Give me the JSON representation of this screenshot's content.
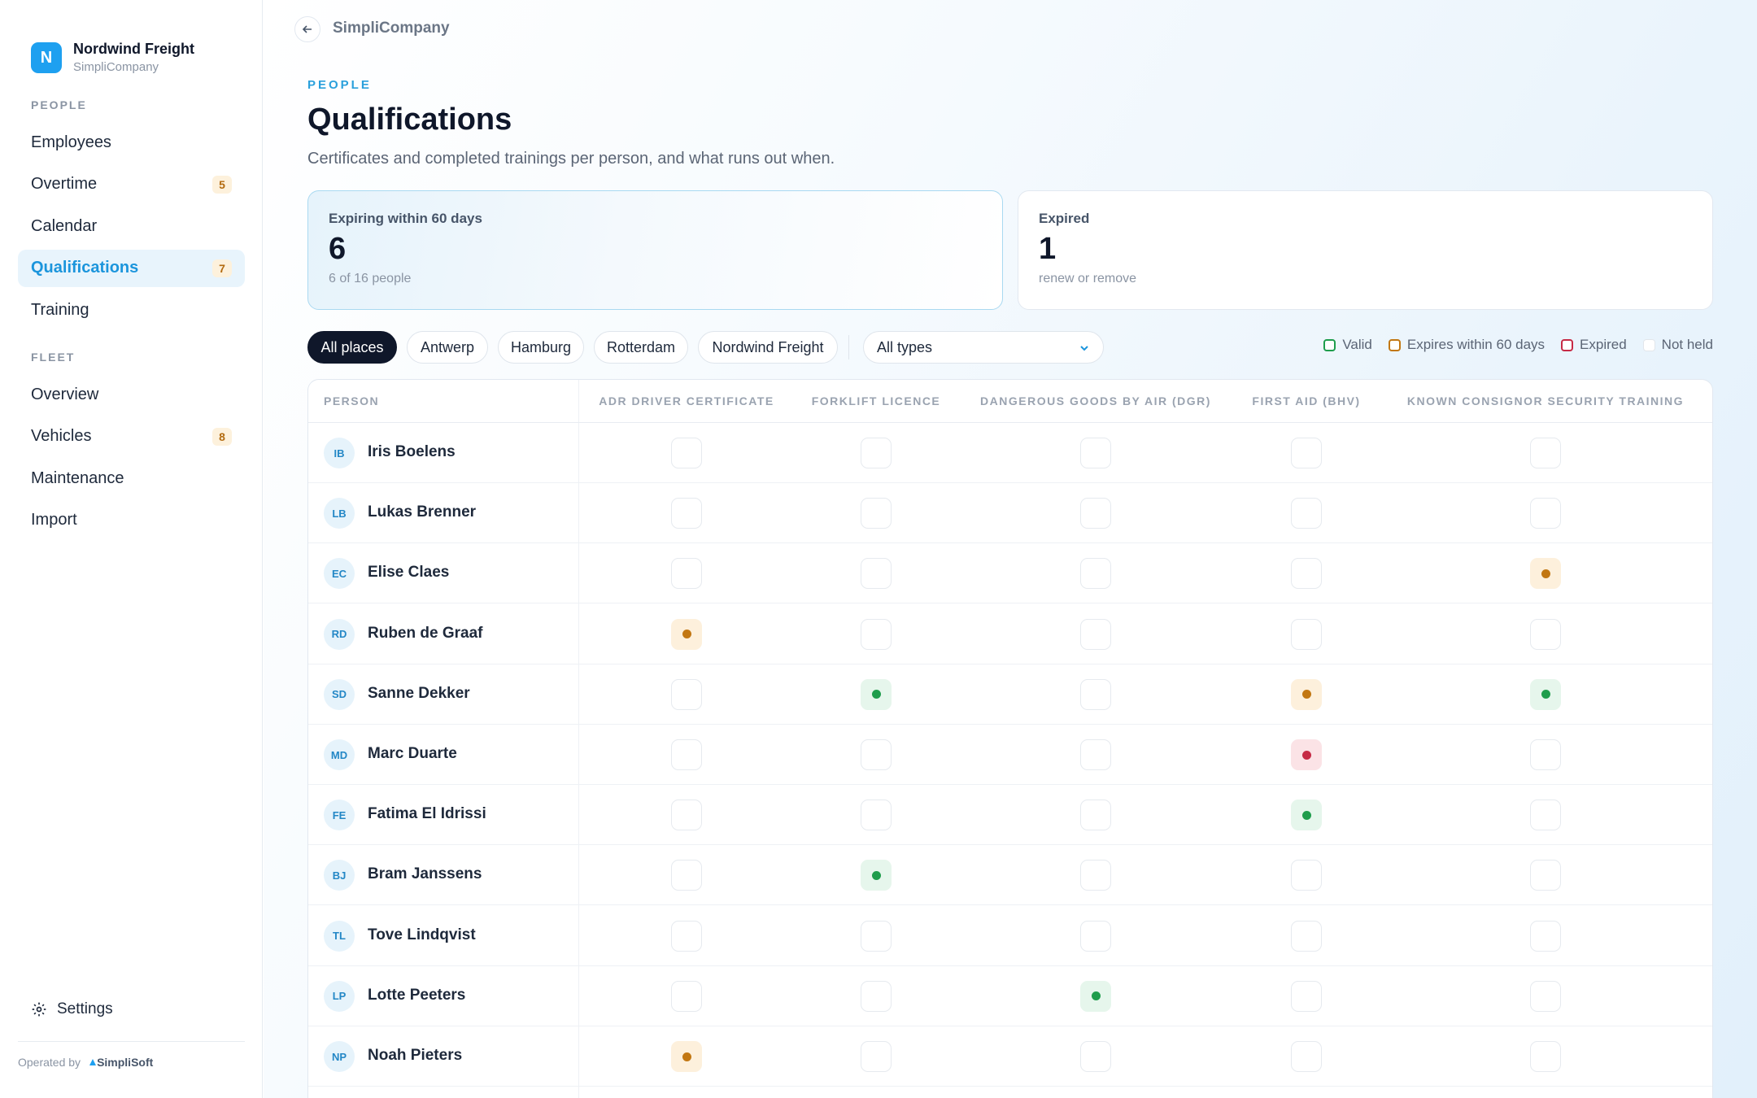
{
  "brand": {
    "logo_letter": "N",
    "name": "Nordwind Freight",
    "sub": "SimpliCompany"
  },
  "nav": {
    "people_label": "PEOPLE",
    "people_items": [
      {
        "label": "Employees",
        "badge": ""
      },
      {
        "label": "Overtime",
        "badge": "5"
      },
      {
        "label": "Calendar",
        "badge": ""
      },
      {
        "label": "Qualifications",
        "badge": "7",
        "active": true
      },
      {
        "label": "Training",
        "badge": ""
      }
    ],
    "fleet_label": "FLEET",
    "fleet_items": [
      {
        "label": "Overview",
        "badge": ""
      },
      {
        "label": "Vehicles",
        "badge": "8"
      },
      {
        "label": "Maintenance",
        "badge": ""
      },
      {
        "label": "Import",
        "badge": ""
      }
    ],
    "settings_label": "Settings",
    "operated_label": "Operated by",
    "operated_brand": "SimpliSoft"
  },
  "header": {
    "breadcrumb": "SimpliCompany",
    "eyebrow": "PEOPLE",
    "title": "Qualifications",
    "description": "Certificates and completed trainings per person, and what runs out when."
  },
  "stats": [
    {
      "label": "Expiring within 60 days",
      "value": "6",
      "sub": "6 of 16 people"
    },
    {
      "label": "Expired",
      "value": "1",
      "sub": "renew or remove"
    }
  ],
  "filters": {
    "places": [
      "All places",
      "Antwerp",
      "Hamburg",
      "Rotterdam",
      "Nordwind Freight"
    ],
    "active_place": "All places",
    "type_select": "All types"
  },
  "legend": [
    {
      "label": "Valid",
      "color": "#1f9d4c"
    },
    {
      "label": "Expires within 60 days",
      "color": "#c27712"
    },
    {
      "label": "Expired",
      "color": "#c62a45"
    },
    {
      "label": "Not held",
      "color": "#e2e6eb"
    }
  ],
  "table": {
    "person_header": "PERSON",
    "columns": [
      "ADR DRIVER CERTIFICATE",
      "FORKLIFT LICENCE",
      "DANGEROUS GOODS BY AIR (DGR)",
      "FIRST AID (BHV)",
      "KNOWN CONSIGNOR SECURITY TRAINING"
    ],
    "rows": [
      {
        "initials": "IB",
        "name": "Iris Boelens",
        "status": [
          "none",
          "none",
          "none",
          "none",
          "none"
        ]
      },
      {
        "initials": "LB",
        "name": "Lukas Brenner",
        "status": [
          "none",
          "none",
          "none",
          "none",
          "none"
        ]
      },
      {
        "initials": "EC",
        "name": "Elise Claes",
        "status": [
          "none",
          "none",
          "none",
          "none",
          "expiring"
        ]
      },
      {
        "initials": "RD",
        "name": "Ruben de Graaf",
        "status": [
          "expiring",
          "none",
          "none",
          "none",
          "none"
        ]
      },
      {
        "initials": "SD",
        "name": "Sanne Dekker",
        "status": [
          "none",
          "valid",
          "none",
          "expiring",
          "valid"
        ]
      },
      {
        "initials": "MD",
        "name": "Marc Duarte",
        "status": [
          "none",
          "none",
          "none",
          "expired",
          "none"
        ]
      },
      {
        "initials": "FE",
        "name": "Fatima El Idrissi",
        "status": [
          "none",
          "none",
          "none",
          "valid",
          "none"
        ]
      },
      {
        "initials": "BJ",
        "name": "Bram Janssens",
        "status": [
          "none",
          "valid",
          "none",
          "none",
          "none"
        ]
      },
      {
        "initials": "TL",
        "name": "Tove Lindqvist",
        "status": [
          "none",
          "none",
          "none",
          "none",
          "none"
        ]
      },
      {
        "initials": "LP",
        "name": "Lotte Peeters",
        "status": [
          "none",
          "none",
          "valid",
          "none",
          "none"
        ]
      },
      {
        "initials": "NP",
        "name": "Noah Pieters",
        "status": [
          "expiring",
          "none",
          "none",
          "none",
          "none"
        ]
      },
      {
        "initials": "",
        "name": "",
        "status": [
          "none",
          "none",
          "none",
          "none",
          "none"
        ]
      }
    ]
  }
}
